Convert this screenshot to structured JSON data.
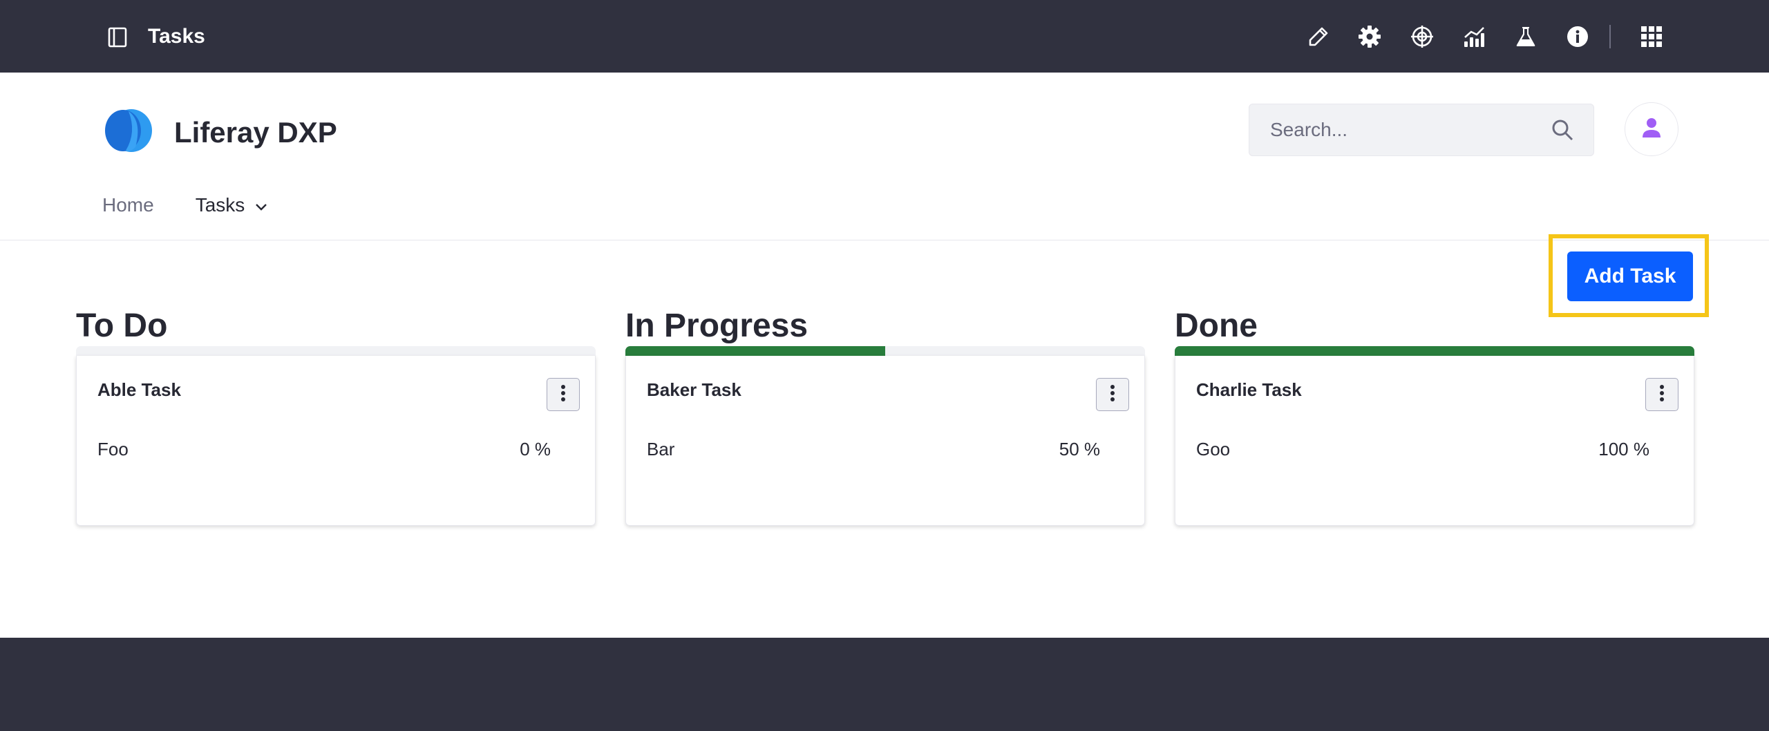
{
  "control_menu": {
    "title": "Tasks",
    "icons": [
      "sidebar-toggle-icon",
      "pencil-icon",
      "gear-icon",
      "target-icon",
      "analytics-icon",
      "flask-icon",
      "info-icon",
      "apps-grid-icon"
    ],
    "icon_color": "#ffffff",
    "background": "#30313f"
  },
  "site": {
    "name": "Liferay DXP",
    "logo_colors": [
      "#1c6ed6",
      "#2e9bf0"
    ]
  },
  "search": {
    "placeholder": "Search..."
  },
  "user": {
    "avatar_color": "#a05ef5"
  },
  "nav": {
    "home_label": "Home",
    "tasks_label": "Tasks"
  },
  "toolbar": {
    "add_task_label": "Add Task",
    "accent": "#0b5fff",
    "highlight": "#f5c518"
  },
  "columns": [
    {
      "title": "To Do",
      "progress": 0,
      "card": {
        "title": "Able Task",
        "description": "Foo",
        "percent": "0 %"
      }
    },
    {
      "title": "In Progress",
      "progress": 0.5,
      "card": {
        "title": "Baker Task",
        "description": "Bar",
        "percent": "50 %"
      }
    },
    {
      "title": "Done",
      "progress": 1,
      "card": {
        "title": "Charlie Task",
        "description": "Goo",
        "percent": "100 %"
      }
    }
  ],
  "progress_color": "#287d3c"
}
